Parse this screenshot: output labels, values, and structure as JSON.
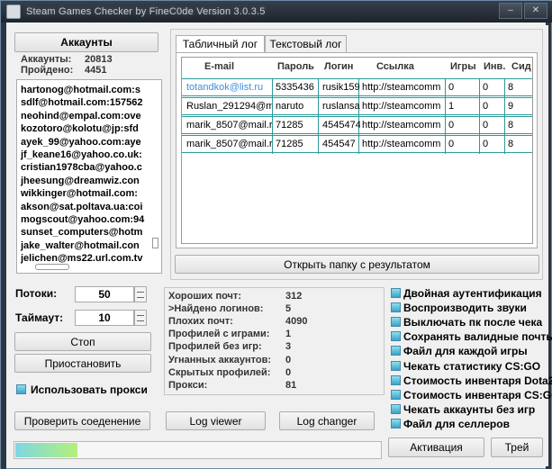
{
  "window": {
    "title": "Steam Games Checker by FineC0de Version 3.0.3.5"
  },
  "accounts": {
    "header_label": "Аккаунты",
    "total_label": "Аккаунты:",
    "total_value": "20813",
    "passed_label": "Пройдено:",
    "passed_value": "4451",
    "list": [
      "hartonog@hotmail.com:s",
      "sdlf@hotmail.com:157562",
      "neohind@empal.com:ove",
      "kozotoro@kolotu@jp:sfd",
      "ayek_99@yahoo.com:aye",
      "jf_keane16@yahoo.co.uk:",
      "cristian1978cba@yahoo.c",
      "jheesung@dreamwiz.con",
      "wikkinger@hotmail.com:",
      "akson@sat.poltava.ua:coi",
      "mogscout@yahoo.com:94",
      "sunset_computers@hotm",
      "jake_walter@hotmail.con",
      "jelichen@ms22.url.com.tv"
    ]
  },
  "log": {
    "tabs": [
      "Табличный лог",
      "Текстовый лог"
    ],
    "columns": [
      "E-mail",
      "Пароль",
      "Логин",
      "Ссылка",
      "Игры",
      "Инв.",
      "Сид"
    ],
    "rows": [
      [
        "totandkok@list.ru",
        "5335436",
        "rusik159",
        "http://steamcomm",
        "0",
        "0",
        "8"
      ],
      [
        "Ruslan_291294@m",
        "naruto",
        "ruslansa",
        "http://steamcomm",
        "1",
        "0",
        "9"
      ],
      [
        "marik_8507@mail.r",
        "71285",
        "4545474",
        "http://steamcomm",
        "0",
        "0",
        "8"
      ],
      [
        "marik_8507@mail.r",
        "71285",
        "454547",
        "http://steamcomm",
        "0",
        "0",
        "8"
      ]
    ],
    "open_folder_label": "Открыть папку с результатом"
  },
  "settings": {
    "threads_label": "Потоки:",
    "threads_value": "50",
    "timeout_label": "Таймаут:",
    "timeout_value": "10",
    "stop_label": "Стоп",
    "pause_label": "Приостановить",
    "use_proxy_label": "Использовать прокси"
  },
  "stats": [
    {
      "label": "Хороших почт:",
      "value": "312"
    },
    {
      "label": ">Найдено логинов:",
      "value": "5"
    },
    {
      "label": "Плохих почт:",
      "value": "4090"
    },
    {
      "label": "Профилей с играми:",
      "value": "1"
    },
    {
      "label": "Профилей без игр:",
      "value": "3"
    },
    {
      "label": "Угнанных аккаунтов:",
      "value": "0"
    },
    {
      "label": "Скрытых профилей:",
      "value": "0"
    },
    {
      "label": "Прокси:",
      "value": "81"
    }
  ],
  "options": [
    "Двойная аутентификация",
    "Воспроизводить звуки",
    "Выключать пк после чека",
    "Сохранять валидные почты",
    "Файл для каждой игры",
    "Чекать статистику CS:GO",
    "Стоимость инвентаря Dota2",
    "Стоимость инвентаря CS:GO",
    "Чекать аккаунты без игр",
    "Файл для селлеров"
  ],
  "bottom": {
    "check_connection_label": "Проверить соеденение",
    "log_viewer_label": "Log viewer",
    "log_changer_label": "Log changer",
    "activation_label": "Активация",
    "trial_label": "Трей",
    "progress_fraction": 0.17
  },
  "colors": {
    "checkbox": "#3aa3cc",
    "row_border": "#2d9a9a",
    "link": "#3b8fdb"
  }
}
